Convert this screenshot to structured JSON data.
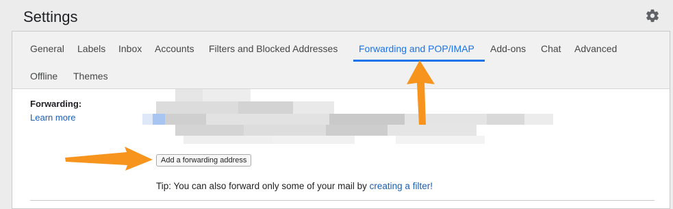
{
  "header": {
    "title": "Settings",
    "settings_icon": "gear-icon"
  },
  "tabs": [
    {
      "label": "General",
      "active": false
    },
    {
      "label": "Labels",
      "active": false
    },
    {
      "label": "Inbox",
      "active": false
    },
    {
      "label": "Accounts",
      "active": false
    },
    {
      "label": "Filters and Blocked Addresses",
      "active": false
    },
    {
      "label": "Forwarding and POP/IMAP",
      "active": true
    },
    {
      "label": "Add-ons",
      "active": false
    },
    {
      "label": "Chat",
      "active": false
    },
    {
      "label": "Advanced",
      "active": false
    },
    {
      "label": "Offline",
      "active": false
    },
    {
      "label": "Themes",
      "active": false
    }
  ],
  "forwarding": {
    "label": "Forwarding:",
    "learn_more": "Learn more",
    "add_button": "Add a forwarding address",
    "tip_prefix": "Tip: You can also forward only some of your mail by ",
    "tip_link": "creating a filter!"
  },
  "colors": {
    "accent": "#1a73e8",
    "link": "#1a5fb4",
    "annotation_arrow": "#f7941d"
  },
  "annotations": {
    "arrow_icons": [
      "arrow-up-icon",
      "arrow-right-icon"
    ]
  }
}
